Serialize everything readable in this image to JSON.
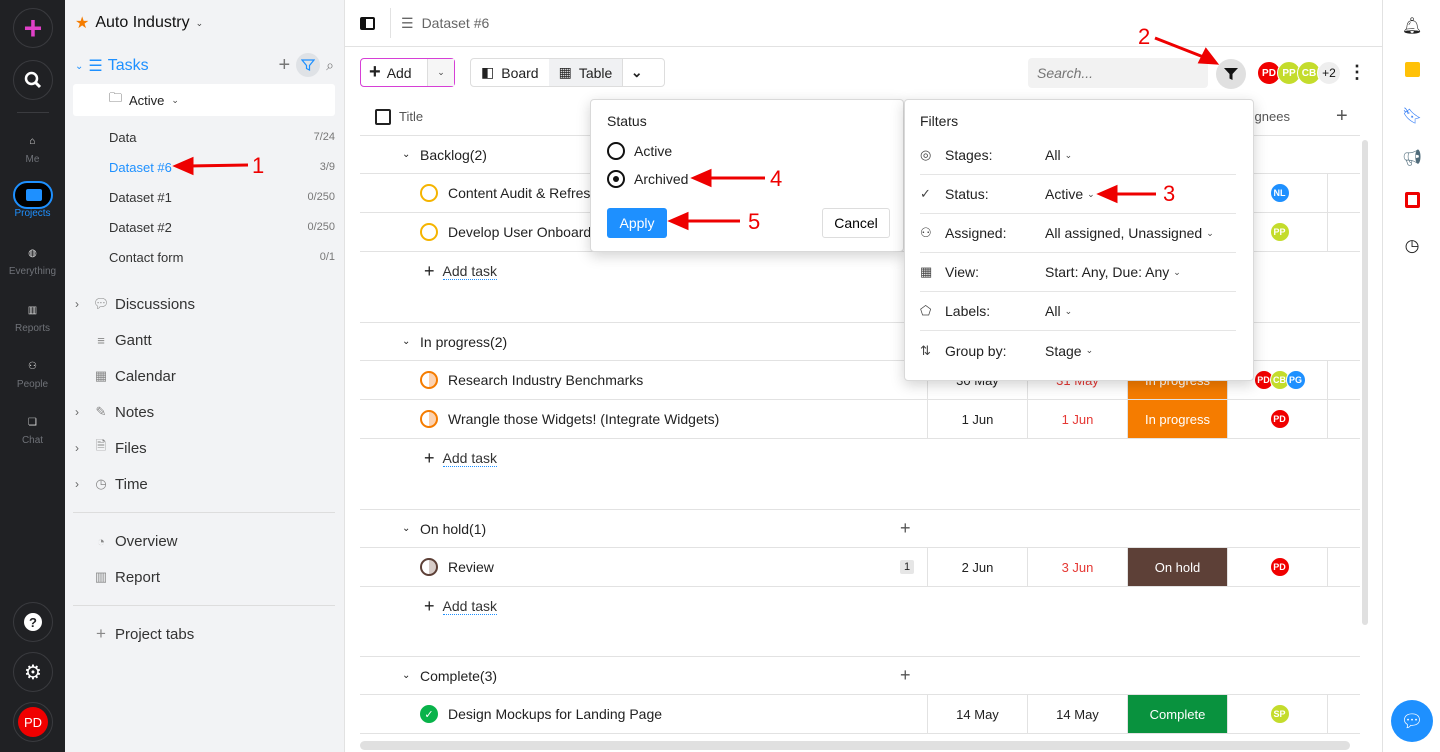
{
  "rail": {
    "nav": [
      {
        "label": "Me",
        "icon": "home-icon"
      },
      {
        "label": "Projects",
        "icon": "folder-icon",
        "active": true
      },
      {
        "label": "Everything",
        "icon": "globe-icon"
      },
      {
        "label": "Reports",
        "icon": "bar-chart-icon"
      },
      {
        "label": "People",
        "icon": "people-icon"
      },
      {
        "label": "Chat",
        "icon": "chat-icon"
      }
    ],
    "avatar": "PD",
    "colors": {
      "add": "#e040c8",
      "active": "#1e90ff",
      "avatar": "#f00000"
    }
  },
  "sidebar": {
    "project": "Auto Industry",
    "tasks_label": "Tasks",
    "active_filter": "Active",
    "lists": [
      {
        "name": "Data",
        "count": "7/24"
      },
      {
        "name": "Dataset #6",
        "count": "3/9",
        "selected": true
      },
      {
        "name": "Dataset #1",
        "count": "0/250"
      },
      {
        "name": "Dataset #2",
        "count": "0/250"
      },
      {
        "name": "Contact form",
        "count": "0/1"
      }
    ],
    "sections": [
      "Discussions",
      "Gantt",
      "Calendar",
      "Notes",
      "Files",
      "Time"
    ],
    "extra": [
      "Overview",
      "Report"
    ],
    "project_tabs": "Project tabs"
  },
  "topbar": {
    "breadcrumb": "Dataset #6"
  },
  "toolbar": {
    "add": "Add",
    "board": "Board",
    "table": "Table",
    "search_placeholder": "Search...",
    "more_count": "+2",
    "avatars": [
      {
        "i": "PD",
        "c": "#f00000"
      },
      {
        "i": "PP",
        "c": "#c4dc2c"
      },
      {
        "i": "CB",
        "c": "#c4dc2c"
      }
    ]
  },
  "table": {
    "headers": {
      "title": "Title",
      "assignees": "Assignees"
    },
    "add_task": "Add task",
    "groups": [
      {
        "name": "Backlog(2)",
        "rows": [
          {
            "title": "Content Audit & Refresh",
            "assignees": [
              {
                "i": "NL",
                "c": "#1e90ff"
              }
            ],
            "status": "backlog"
          },
          {
            "title": "Develop User Onboarding",
            "assignees": [
              {
                "i": "PP",
                "c": "#c4dc2c"
              }
            ],
            "status": "backlog"
          }
        ]
      },
      {
        "name": "In progress(2)",
        "rows": [
          {
            "title": "Research Industry Benchmarks",
            "start": "30 May",
            "due": "31 May",
            "stage": "In progress",
            "stage_color": "#f57c00",
            "assignees": [
              {
                "i": "PD",
                "c": "#f00000"
              },
              {
                "i": "CB",
                "c": "#c4dc2c"
              },
              {
                "i": "PG",
                "c": "#1e90ff"
              }
            ],
            "status": "progress"
          },
          {
            "title": "Wrangle those Widgets! (Integrate Widgets)",
            "start": "1 Jun",
            "due": "1 Jun",
            "stage": "In progress",
            "stage_color": "#f57c00",
            "assignees": [
              {
                "i": "PD",
                "c": "#f00000"
              }
            ],
            "status": "progress"
          }
        ]
      },
      {
        "name": "On hold(1)",
        "rows": [
          {
            "title": "Review",
            "comments": "1",
            "start": "2 Jun",
            "due": "3 Jun",
            "stage": "On hold",
            "stage_color": "#5d4037",
            "assignees": [
              {
                "i": "PD",
                "c": "#f00000"
              }
            ],
            "status": "hold"
          }
        ]
      },
      {
        "name": "Complete(3)",
        "rows": [
          {
            "title": "Design Mockups for Landing Page",
            "start": "14 May",
            "due": "14 May",
            "stage": "Complete",
            "stage_color": "#09923e",
            "assignees": [
              {
                "i": "SP",
                "c": "#c4dc2c"
              }
            ],
            "status": "done"
          }
        ]
      }
    ]
  },
  "status_popup": {
    "title": "Status",
    "options": [
      {
        "label": "Active",
        "checked": false
      },
      {
        "label": "Archived",
        "checked": true
      }
    ],
    "apply": "Apply",
    "cancel": "Cancel"
  },
  "filters_popup": {
    "title": "Filters",
    "rows": [
      {
        "icon": "check-circle-icon",
        "key": "Stages:",
        "value": "All"
      },
      {
        "icon": "check-icon",
        "key": "Status:",
        "value": "Active"
      },
      {
        "icon": "people-icon",
        "key": "Assigned:",
        "value": "All assigned, Unassigned"
      },
      {
        "icon": "calendar-icon",
        "key": "View:",
        "value": "Start: Any, Due: Any"
      },
      {
        "icon": "tag-icon",
        "key": "Labels:",
        "value": "All"
      },
      {
        "icon": "sort-icon",
        "key": "Group by:",
        "value": "Stage"
      }
    ]
  },
  "annotations": [
    "1",
    "2",
    "3",
    "4",
    "5"
  ]
}
